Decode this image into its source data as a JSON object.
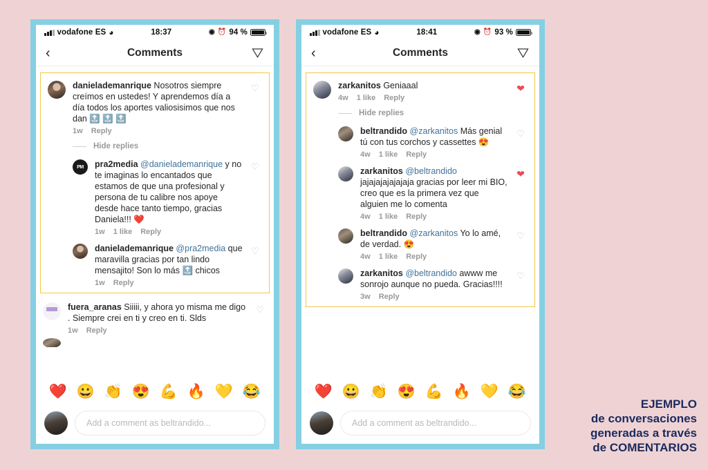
{
  "canvas": {
    "background_color": "#efd3d4",
    "phone_frame_color": "#85cfe3",
    "highlight_border_color": "#f2c945",
    "accent_link_color": "#3f729b",
    "heart_color": "#ed4956",
    "caption_color": "#1b2a5e"
  },
  "caption": {
    "line1": "EJEMPLO",
    "line2": "de conversaciones",
    "line3": "generadas a través",
    "line4": "de COMENTARIOS"
  },
  "phone1": {
    "status_bar": {
      "carrier": "vodafone ES",
      "time": "18:37",
      "battery_percent": "94 %",
      "signal_icon": "signal-bars-icon",
      "wifi_icon": "wifi-icon",
      "location_icon": "location-arrow-icon",
      "alarm_icon": "alarm-clock-icon",
      "battery_icon": "battery-icon"
    },
    "nav": {
      "back_icon": "chevron-left-icon",
      "title": "Comments",
      "send_icon": "direct-message-icon"
    },
    "comments": [
      {
        "username": "daniela demanrique",
        "username_display": "danielademanrique",
        "text": " Nosotros siempre creímos en ustedes! Y aprendemos día a día todos los aportes valiosisimos que nos dan 🔝 🔝 🔝",
        "time": "1w",
        "likes": "",
        "reply_label": "Reply",
        "liked": false,
        "avatar": "av-a"
      },
      {
        "hide_replies_label": "Hide replies"
      },
      {
        "username_display": "pra2media",
        "mention": "@danielademanrique",
        "text": " y no te imaginas lo encantados que estamos de que una profesional y persona de tu calibre nos apoye desde hace tanto tiempo, gracias Daniela!!! ❤️",
        "time": "1w",
        "likes": "1 like",
        "reply_label": "Reply",
        "liked": false,
        "avatar": "av-b"
      },
      {
        "username_display": "danielademanrique",
        "mention": "@pra2media",
        "text": " que maravilla gracias por tan lindo mensajito! Son lo más 🔝 chicos",
        "time": "1w",
        "likes": "",
        "reply_label": "Reply",
        "liked": false,
        "avatar": "av-a"
      },
      {
        "username_display": "fuera_aranas",
        "text": " Siiiii,  y ahora yo misma me digo . Siempre crei en ti y creo en ti. Slds",
        "time": "1w",
        "likes": "",
        "reply_label": "Reply",
        "liked": false,
        "avatar": "av-c"
      }
    ],
    "emoji_bar": [
      "❤️",
      "😀",
      "👏",
      "😍",
      "💪",
      "🔥",
      "💛",
      "😂"
    ],
    "composer": {
      "placeholder": "Add a comment as beltrandido...",
      "value": ""
    }
  },
  "phone2": {
    "status_bar": {
      "carrier": "vodafone ES",
      "time": "18:41",
      "battery_percent": "93 %",
      "signal_icon": "signal-bars-icon",
      "wifi_icon": "wifi-icon",
      "location_icon": "location-arrow-icon",
      "alarm_icon": "alarm-clock-icon",
      "battery_icon": "battery-icon"
    },
    "nav": {
      "back_icon": "chevron-left-icon",
      "title": "Comments",
      "send_icon": "direct-message-icon"
    },
    "comments": [
      {
        "username_display": "zarkanitos",
        "text": " Geniaaal",
        "time": "4w",
        "likes": "1 like",
        "reply_label": "Reply",
        "liked": true,
        "avatar": "av-d"
      },
      {
        "hide_replies_label": "Hide replies"
      },
      {
        "username_display": "beltrandido",
        "mention": "@zarkanitos",
        "text": " Más genial tú con tus corchos y cassettes 😍",
        "time": "4w",
        "likes": "1 like",
        "reply_label": "Reply",
        "liked": false,
        "avatar": "av-e"
      },
      {
        "username_display": "zarkanitos",
        "mention": "@beltrandido",
        "text": " jajajajajajajaja gracias por leer mi BIO, creo que es la primera vez que alguien me lo comenta",
        "time": "4w",
        "likes": "1 like",
        "reply_label": "Reply",
        "liked": true,
        "avatar": "av-d"
      },
      {
        "username_display": "beltrandido",
        "mention": "@zarkanitos",
        "text": " Yo lo amé, de verdad. 😍",
        "time": "4w",
        "likes": "1 like",
        "reply_label": "Reply",
        "liked": false,
        "avatar": "av-e"
      },
      {
        "username_display": "zarkanitos",
        "mention": "@beltrandido",
        "text": " awww me sonrojo aunque no pueda. Gracias!!!!",
        "time": "3w",
        "likes": "",
        "reply_label": "Reply",
        "liked": false,
        "avatar": "av-d"
      }
    ],
    "emoji_bar": [
      "❤️",
      "😀",
      "👏",
      "😍",
      "💪",
      "🔥",
      "💛",
      "😂"
    ],
    "composer": {
      "placeholder": "Add a comment as beltrandido...",
      "value": ""
    }
  }
}
